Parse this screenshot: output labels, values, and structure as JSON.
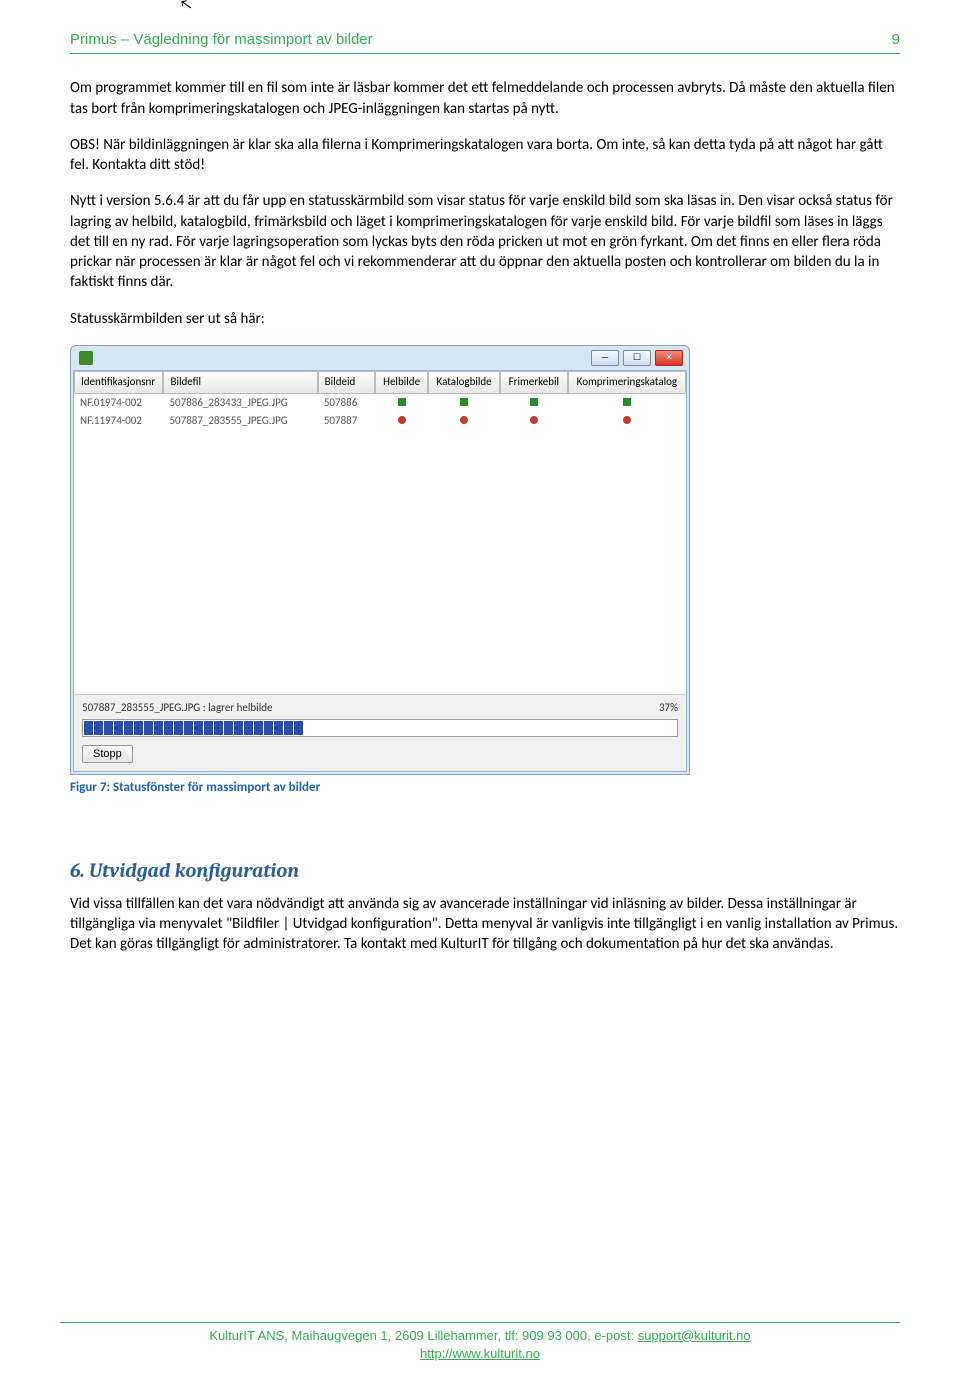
{
  "header": {
    "title": "Primus – Vägledning för massimport av bilder",
    "page_number": "9"
  },
  "body": {
    "p1": "Om programmet kommer till en fil som inte är läsbar kommer det ett felmeddelande och processen avbryts. Då måste den aktuella filen tas bort från komprimeringskatalogen och JPEG-inläggningen kan startas på nytt.",
    "p2": "OBS! När bildinläggningen är klar ska alla filerna i Komprimeringskatalogen vara borta. Om inte, så kan detta tyda på att något har gått fel. Kontakta ditt stöd!",
    "p3": "Nytt i version 5.6.4 är att du får upp en statusskärmbild som visar status för varje enskild bild som ska läsas in. Den visar också status för lagring av helbild, katalogbild, frimärksbild och läget i komprimeringskatalogen för varje enskild bild. För varje bildfil som läses in läggs det till en ny rad. För varje lagringsoperation som lyckas byts den röda pricken ut mot en grön fyrkant. Om det finns en eller flera röda prickar när processen är klar är något fel och vi rekommenderar att du öppnar den aktuella posten och kontrollerar om bilden du la in faktiskt finns där.",
    "p4": "Statusskärmbilden ser ut så här:"
  },
  "screenshot": {
    "columns": {
      "id": "Identifikasjonsnr",
      "file": "Bildefil",
      "bid": "Bildeid",
      "hel": "Helbilde",
      "kat": "Katalogbilde",
      "fri": "Frimerkebil",
      "komp": "Komprimeringskatalog"
    },
    "rows": [
      {
        "id": "NF.01974-002",
        "file": "507886_283433_JPEG.JPG",
        "bid": "507886",
        "hel": "g",
        "kat": "g",
        "fri": "g",
        "komp": "g"
      },
      {
        "id": "NF.11974-002",
        "file": "507887_283555_JPEG.JPG",
        "bid": "507887",
        "hel": "r",
        "kat": "r",
        "fri": "r",
        "komp": "r"
      }
    ],
    "status_text": "507887_283555_JPEG.JPG : lagrer helbilde",
    "percent": "37%",
    "stop_label": "Stopp"
  },
  "caption": "Figur 7: Statusfönster för massimport av bilder",
  "section6": {
    "heading": "6. Utvidgad konfiguration",
    "text": "Vid vissa tillfällen kan det vara nödvändigt att använda sig av avancerade inställningar vid inläsning av bilder. Dessa inställningar är tillgängliga via menyvalet \"Bildfiler | Utvidgad konfiguration\". Detta menyval är vanligvis inte tillgängligt i en vanlig installation av Primus. Det kan göras tillgängligt för administratorer. Ta kontakt med KulturIT för tillgång och dokumentation på hur det ska användas."
  },
  "footer": {
    "line1a": "KulturIT ANS, Maihaugvegen 1, 2609 Lillehammer, tlf: 909 93 000, e-post: ",
    "email": "support@kulturit.no",
    "line2": "http://www.kulturit.no"
  }
}
